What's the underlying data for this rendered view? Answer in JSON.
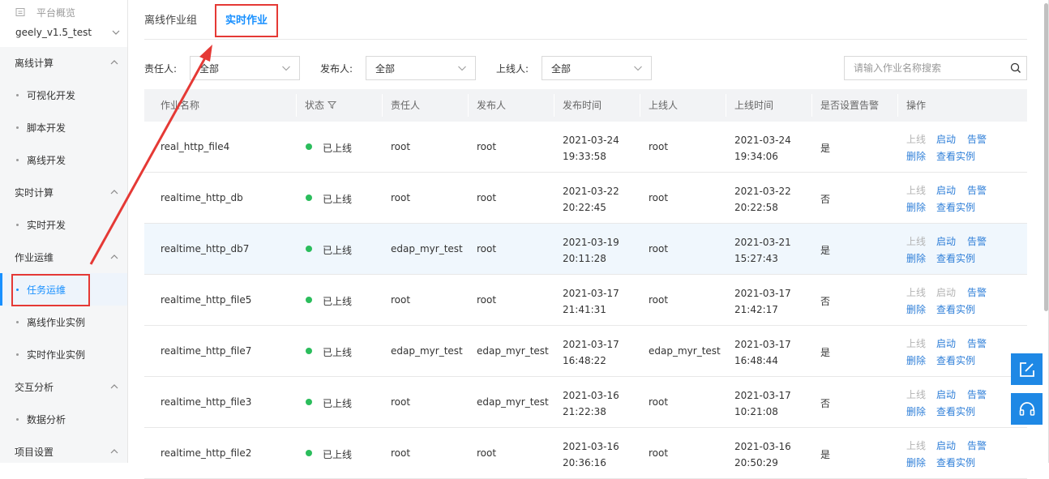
{
  "sidebar": {
    "overview_label": "平台概览",
    "project": "geely_v1.5_test",
    "groups": [
      {
        "label": "离线计算",
        "items": [
          "可视化开发",
          "脚本开发",
          "离线开发"
        ]
      },
      {
        "label": "实时计算",
        "items": [
          "实时开发"
        ]
      },
      {
        "label": "作业运维",
        "items": [
          "任务运维",
          "离线作业实例",
          "实时作业实例"
        ]
      },
      {
        "label": "交互分析",
        "items": [
          "数据分析"
        ]
      },
      {
        "label": "项目设置",
        "items": []
      }
    ],
    "active_item": "任务运维"
  },
  "tabs": [
    "离线作业组",
    "实时作业"
  ],
  "active_tab": "实时作业",
  "filters": {
    "owner_label": "责任人:",
    "owner_value": "全部",
    "publisher_label": "发布人:",
    "publisher_value": "全部",
    "onliner_label": "上线人:",
    "onliner_value": "全部",
    "search_placeholder": "请输入作业名称搜索"
  },
  "table": {
    "headers": [
      "作业名称",
      "状态",
      "责任人",
      "发布人",
      "发布时间",
      "上线人",
      "上线时间",
      "是否设置告警",
      "操作"
    ],
    "rows": [
      {
        "name": "real_http_file4",
        "status": "已上线",
        "owner": "root",
        "publisher": "root",
        "publish_date": "2021-03-24",
        "publish_time": "19:33:58",
        "onliner": "root",
        "online_date": "2021-03-24",
        "online_time": "19:34:06",
        "alarm": "是"
      },
      {
        "name": "realtime_http_db",
        "status": "已上线",
        "owner": "root",
        "publisher": "root",
        "publish_date": "2021-03-22",
        "publish_time": "20:22:45",
        "onliner": "root",
        "online_date": "2021-03-22",
        "online_time": "20:22:58",
        "alarm": "否"
      },
      {
        "name": "realtime_http_db7",
        "status": "已上线",
        "owner": "edap_myr_test",
        "publisher": "root",
        "publish_date": "2021-03-19",
        "publish_time": "20:11:28",
        "onliner": "root",
        "online_date": "2021-03-21",
        "online_time": "15:27:43",
        "alarm": "是"
      },
      {
        "name": "realtime_http_file5",
        "status": "已上线",
        "owner": "root",
        "publisher": "root",
        "publish_date": "2021-03-17",
        "publish_time": "21:41:31",
        "onliner": "root",
        "online_date": "2021-03-17",
        "online_time": "21:42:17",
        "alarm": "否"
      },
      {
        "name": "realtime_http_file7",
        "status": "已上线",
        "owner": "edap_myr_test",
        "publisher": "edap_myr_test",
        "publish_date": "2021-03-17",
        "publish_time": "16:48:22",
        "onliner": "edap_myr_test",
        "online_date": "2021-03-17",
        "online_time": "16:48:44",
        "alarm": "是"
      },
      {
        "name": "realtime_http_file3",
        "status": "已上线",
        "owner": "root",
        "publisher": "edap_myr_test",
        "publish_date": "2021-03-16",
        "publish_time": "21:22:38",
        "onliner": "root",
        "online_date": "2021-03-17",
        "online_time": "10:21:08",
        "alarm": "否"
      },
      {
        "name": "realtime_http_file2",
        "status": "已上线",
        "owner": "root",
        "publisher": "root",
        "publish_date": "2021-03-16",
        "publish_time": "20:36:16",
        "onliner": "root",
        "online_date": "2021-03-16",
        "online_time": "20:50:29",
        "alarm": "是"
      }
    ],
    "actions": {
      "offline": "上线",
      "start": "启动",
      "alarm": "告警",
      "delete": "删除",
      "view": "查看实例"
    }
  },
  "colors": {
    "primary": "#1890ff",
    "link": "#2f7fd8",
    "status_online": "#2bbd5c",
    "highlight": "#e53935"
  }
}
